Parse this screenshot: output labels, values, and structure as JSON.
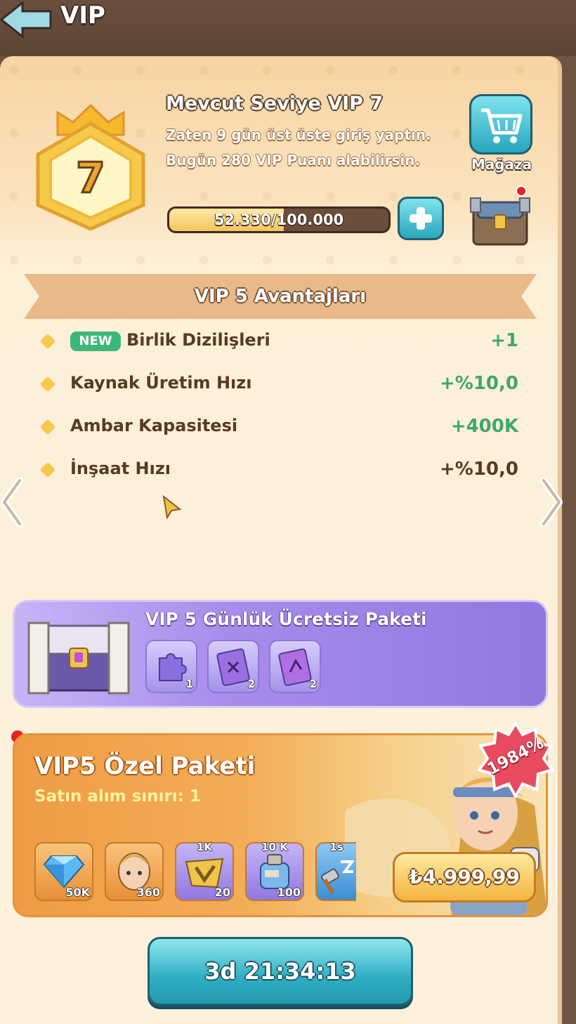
{
  "header": {
    "title": "VIP",
    "back_icon": "back-arrow-icon"
  },
  "vip_status": {
    "badge_level": "7",
    "level_title": "Mevcut Seviye VIP 7",
    "streak_line_1": "Zaten 9 gün üst üste giriş yaptın.",
    "streak_line_2": "Bugün 280 VIP Puanı alabilirsin.",
    "points_text": "52.330/100.000",
    "points_current": 52330,
    "points_max": 100000,
    "progress_fraction": 0.5233
  },
  "shop": {
    "label": "Mağaza",
    "icon": "cart-icon"
  },
  "benefits": {
    "title": "VIP 5 Avantajları",
    "rows": [
      {
        "new": "NEW",
        "label": "Birlik Dizilişleri",
        "value": "+1",
        "color": "#3fa86b"
      },
      {
        "label": "Kaynak Üretim Hızı",
        "value": "+%10,0",
        "color": "#3fa86b"
      },
      {
        "label": "Ambar Kapasitesi",
        "value": "+400K",
        "color": "#3fa86b"
      },
      {
        "label": "İnşaat Hızı",
        "value": "+%10,0",
        "color": "#5a3a22"
      }
    ]
  },
  "daily_pack": {
    "title": "VIP 5 Günlük Ücretsiz Paketi",
    "items": [
      {
        "icon": "puzzle-piece-icon",
        "count": "1"
      },
      {
        "icon": "scroll-icon",
        "count": "2"
      },
      {
        "icon": "scroll-icon",
        "count": "2"
      }
    ]
  },
  "special_pack": {
    "title": "VIP5 Özel Paketi",
    "limit": "Satın alım sınırı: 1",
    "discount": "1984%",
    "price": "₺4.999,99",
    "rewards": [
      {
        "icon": "diamond-icon",
        "top": "",
        "count": "50K"
      },
      {
        "icon": "hero-portrait-icon",
        "top": "",
        "count": "360"
      },
      {
        "icon": "gold-chevron-icon",
        "top": "1K",
        "count": "20"
      },
      {
        "icon": "potion-icon",
        "top": "10 K",
        "count": "100"
      },
      {
        "icon": "speedup-hammer-icon",
        "top": "1s",
        "count": ""
      }
    ]
  },
  "timer": {
    "label": "3d 21:34:13"
  },
  "colors": {
    "accent_teal": "#2aa6bd",
    "value_green": "#3fa86b",
    "panel": "#fdf1dc",
    "purple": "#a88ceb",
    "orange": "#f3ae58"
  }
}
